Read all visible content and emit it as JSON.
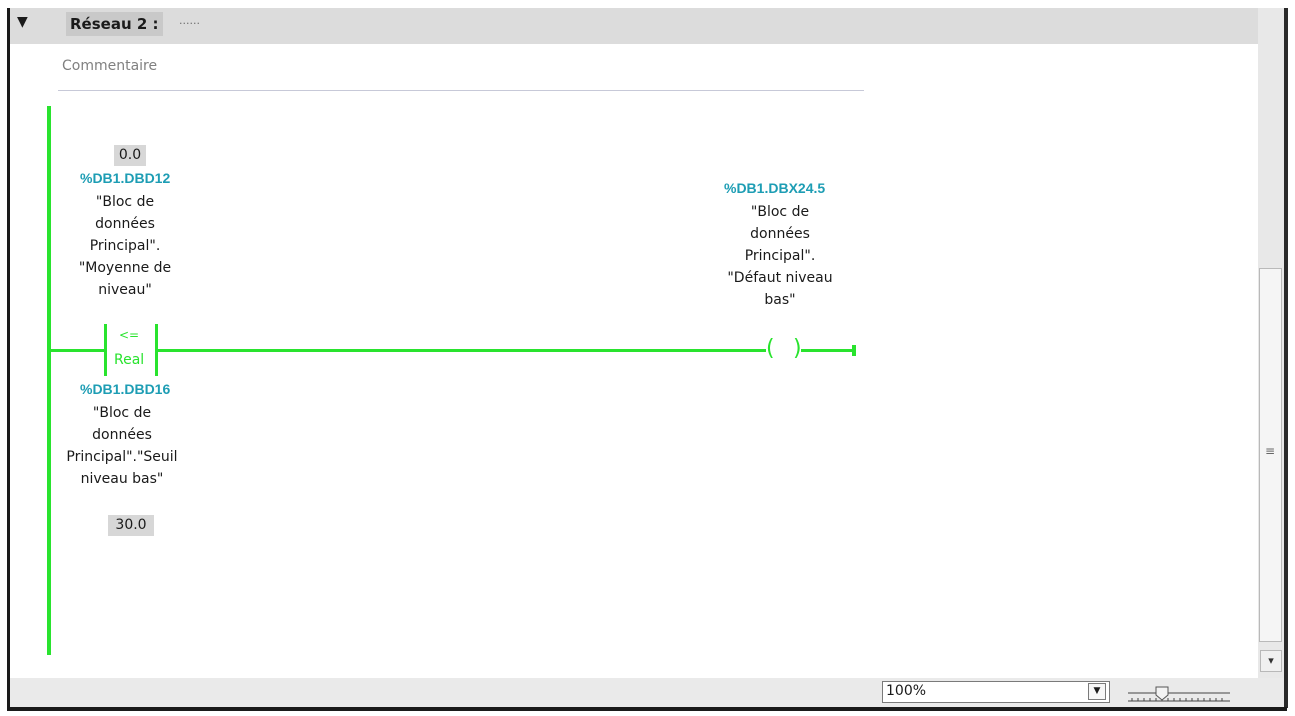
{
  "network": {
    "title": "Réseau 2 :",
    "dots": "......",
    "comment_placeholder": "Commentaire"
  },
  "compare_contact": {
    "operator": "<=",
    "type": "Real",
    "in1": {
      "value": "0.0",
      "address": "%DB1.DBD12",
      "symbol": "\"Bloc de\ndonnées\nPrincipal\".\n\"Moyenne de\nniveau\""
    },
    "in2": {
      "value": "30.0",
      "address": "%DB1.DBD16",
      "symbol": "\"Bloc de\ndonnées\nPrincipal\".\"Seuil\nniveau bas\""
    }
  },
  "coil": {
    "address": "%DB1.DBX24.5",
    "symbol": "\"Bloc de\ndonnées\nPrincipal\".\n\"Défaut niveau\nbas\"",
    "open_paren": "(",
    "close_paren": ")"
  },
  "statusbar": {
    "zoom_value": "100%"
  },
  "icons": {
    "collapse": "triangle-down-icon",
    "dropdown": "dropdown-arrow-icon",
    "scroll_down": "chevron-down-icon",
    "grip": "scroll-grip-icon"
  },
  "colors": {
    "wire": "#29e32e",
    "address": "#1d9db4",
    "header_bg": "#dcdcdc"
  }
}
